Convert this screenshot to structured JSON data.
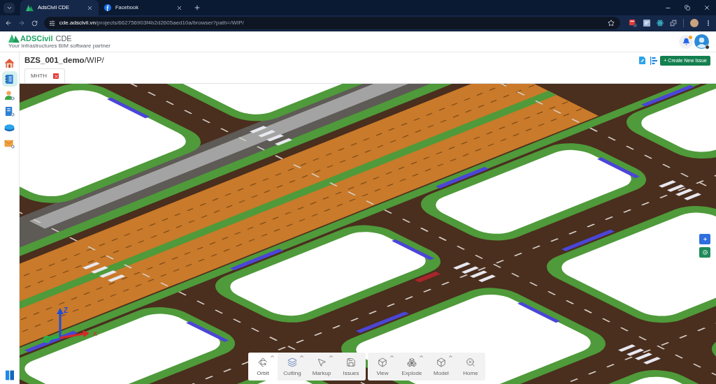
{
  "browser": {
    "tabs": [
      {
        "title": "AdsCivil CDE",
        "selected": true
      },
      {
        "title": "Facebook",
        "selected": false
      }
    ],
    "address": {
      "host": "cde.adscivil.vn",
      "path": "/projects/662756903f4b2d2605aed10a/browser?path=/WIP/"
    }
  },
  "app_header": {
    "logo": {
      "brand": "ADSCivil",
      "product": "CDE",
      "tagline": "Your Infrastructures BIM software partner"
    },
    "notifications": {
      "unread": true
    }
  },
  "sidebar": {
    "items": [
      {
        "selected": false
      },
      {
        "selected": true
      },
      {
        "selected": false
      },
      {
        "selected": false
      },
      {
        "selected": false
      },
      {
        "selected": false
      }
    ]
  },
  "page": {
    "title": "**BZS_001_demo**/WIP/",
    "create_button": "+ Create New Issue"
  },
  "file_tabs": [
    {
      "label": "MHTH",
      "selected": true
    }
  ],
  "viewer": {
    "axis_labels": {
      "z": "Z",
      "x": "X"
    }
  },
  "toolbar": {
    "groups": [
      {
        "tools": [
          {
            "label": "Orbit",
            "has_menu": true,
            "selected": true
          },
          {
            "label": "Cutting",
            "has_menu": true,
            "selected": false
          },
          {
            "label": "Markup",
            "has_menu": true,
            "selected": false
          },
          {
            "label": "Issues",
            "has_menu": false,
            "selected": false
          }
        ]
      },
      {
        "tools": [
          {
            "label": "View",
            "has_menu": true,
            "selected": false
          },
          {
            "label": "Explode",
            "has_menu": true,
            "selected": false
          },
          {
            "label": "Model",
            "has_menu": true,
            "selected": false
          },
          {
            "label": "Home",
            "has_menu": false,
            "selected": false
          }
        ]
      }
    ]
  }
}
